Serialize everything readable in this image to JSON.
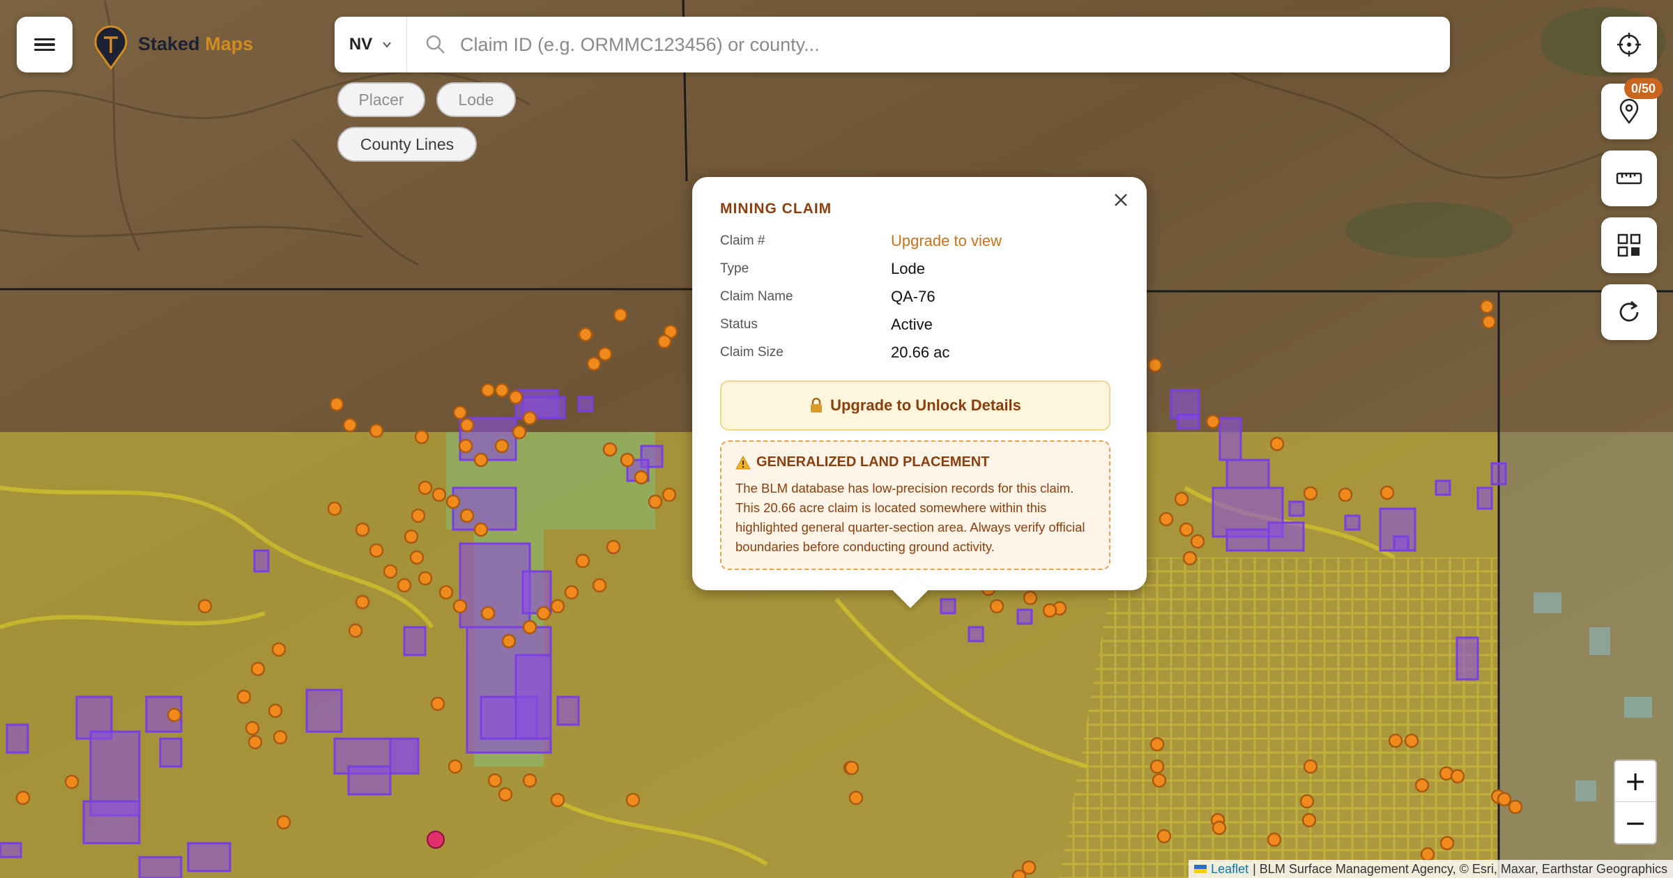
{
  "brand": {
    "name_part1": "Staked",
    "name_part2": "Maps"
  },
  "search": {
    "state": "NV",
    "placeholder": "Claim ID (e.g. ORMMC123456) or county..."
  },
  "filters": {
    "placer": "Placer",
    "lode": "Lode",
    "county_lines": "County Lines"
  },
  "toolbar": {
    "claims_badge": "0/50"
  },
  "zoom": {
    "in": "+",
    "out": "−"
  },
  "attribution": {
    "leaflet": "Leaflet",
    "sources": "| BLM Surface Management Agency, © Esri, Maxar, Earthstar Geographics"
  },
  "popup": {
    "title": "MINING CLAIM",
    "rows": [
      {
        "label": "Claim #",
        "value": "Upgrade to view"
      },
      {
        "label": "Type",
        "value": "Lode"
      },
      {
        "label": "Claim Name",
        "value": "QA-76"
      },
      {
        "label": "Status",
        "value": "Active"
      },
      {
        "label": "Claim Size",
        "value": "20.66 ac"
      }
    ],
    "unlock_button": "Upgrade to Unlock Details",
    "warning_title": "GENERALIZED LAND PLACEMENT",
    "warning_body": "The BLM database has low-precision records for this claim. This 20.66 acre claim is located somewhere within this highlighted general quarter-section area. Always verify official boundaries before conducting ground activity."
  },
  "colors": {
    "accent": "#d38a1e",
    "claim_marker": "#f08a1c",
    "claim_polygon": "#8a4fe0",
    "blm_overlay": "#d4c33a",
    "popup_title": "#8a3f0e"
  }
}
